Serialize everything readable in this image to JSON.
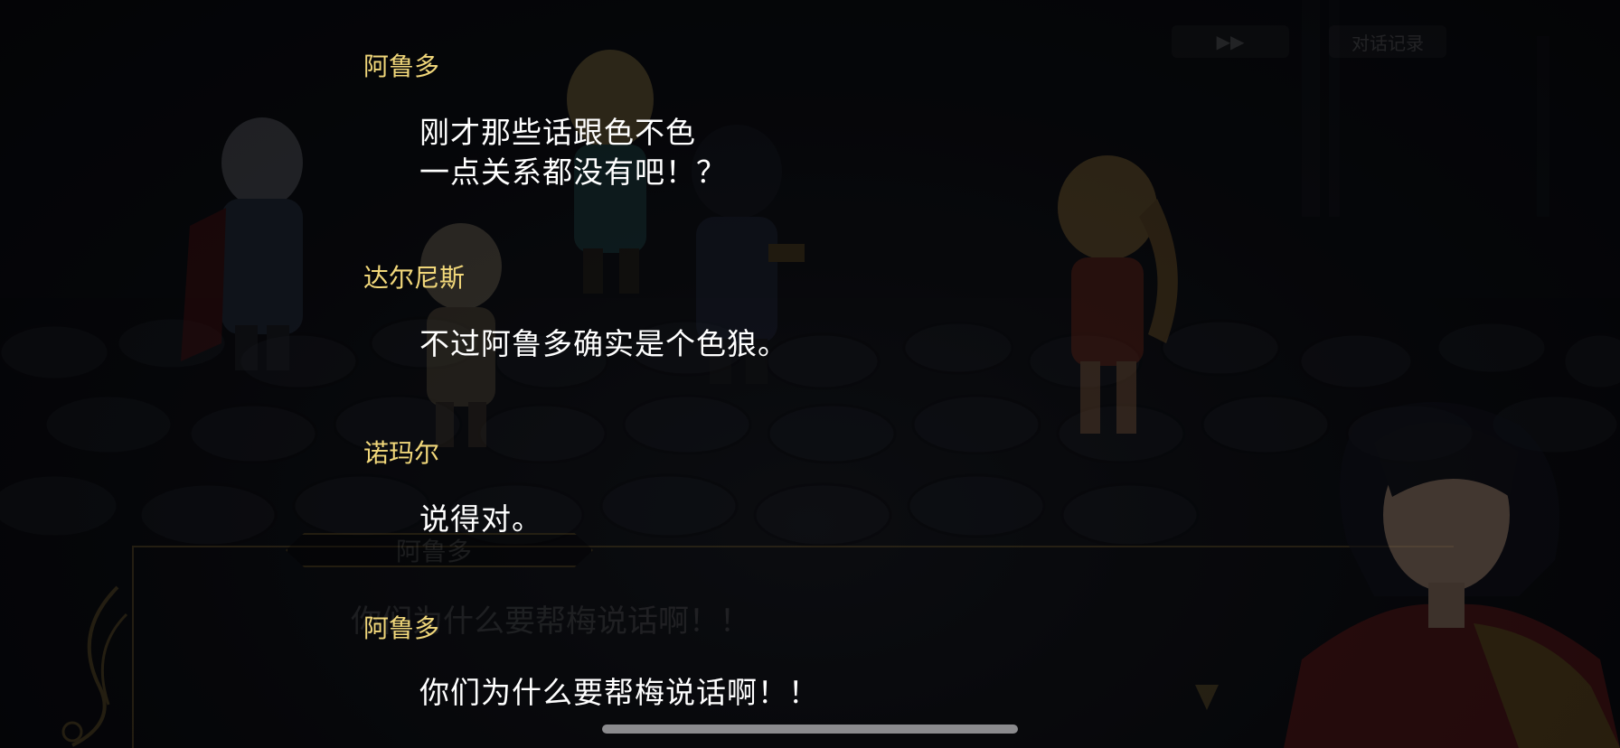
{
  "top_bar": {
    "fast_forward_icon": "double-play-icon",
    "log_button_label": "对话记录"
  },
  "background_dialogue": {
    "speaker": "阿鲁多",
    "text": "你们为什么要帮梅说话啊！！"
  },
  "log_entries": [
    {
      "speaker": "阿鲁多",
      "lines": [
        "刚才那些话跟色不色",
        "一点关系都没有吧！？"
      ]
    },
    {
      "speaker": "达尔尼斯",
      "lines": [
        "不过阿鲁多确实是个色狼。"
      ]
    },
    {
      "speaker": "诺玛尔",
      "lines": [
        "说得对。"
      ]
    },
    {
      "speaker": "阿鲁多",
      "lines": [
        "你们为什么要帮梅说话啊！！"
      ]
    }
  ],
  "colors": {
    "speaker_name": "#f1d77a",
    "dialogue_text": "#ffffff",
    "frame_gold": "#a0823c"
  }
}
